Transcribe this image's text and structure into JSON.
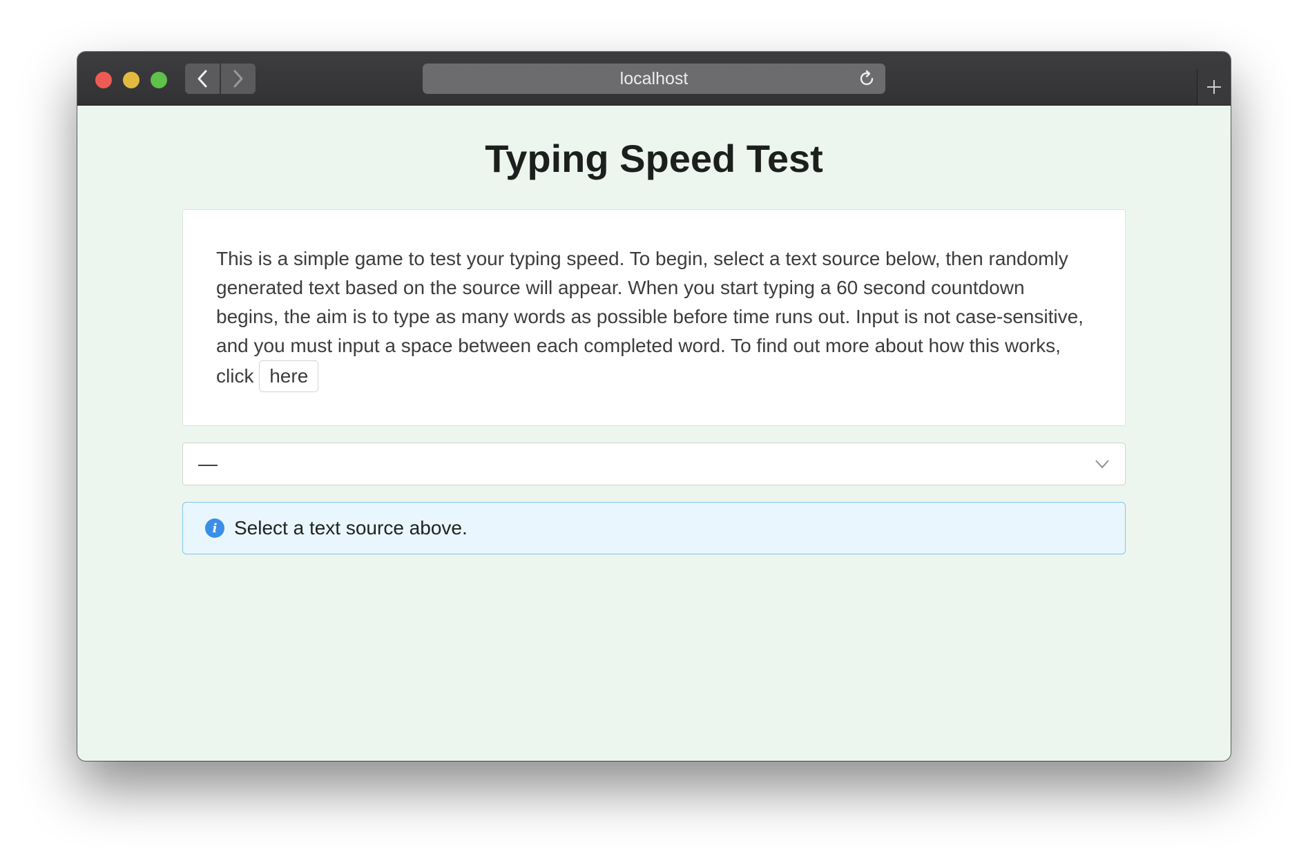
{
  "browser": {
    "url": "localhost",
    "controls": {
      "back": "chevron-left-icon",
      "forward": "chevron-right-icon",
      "reload": "reload-icon",
      "new_tab": "plus-icon"
    }
  },
  "page": {
    "title": "Typing Speed Test",
    "intro_text": "This is a simple game to test your typing speed. To begin, select a text source below, then randomly generated text based on the source will appear. When you start typing a 60 second countdown begins, the aim is to type as many words as possible before time runs out. Input is not case-sensitive, and you must input a space between each completed word. To find out more about how this works, click",
    "here_label": "here",
    "text_source_select": {
      "selected_value": "—"
    },
    "info_alert": {
      "message": "Select a text source above."
    }
  },
  "colors": {
    "page_background": "#ecf5ee",
    "info_background": "#e9f6fd",
    "info_border": "#7cc7ef",
    "info_icon": "#3b8ee8"
  }
}
